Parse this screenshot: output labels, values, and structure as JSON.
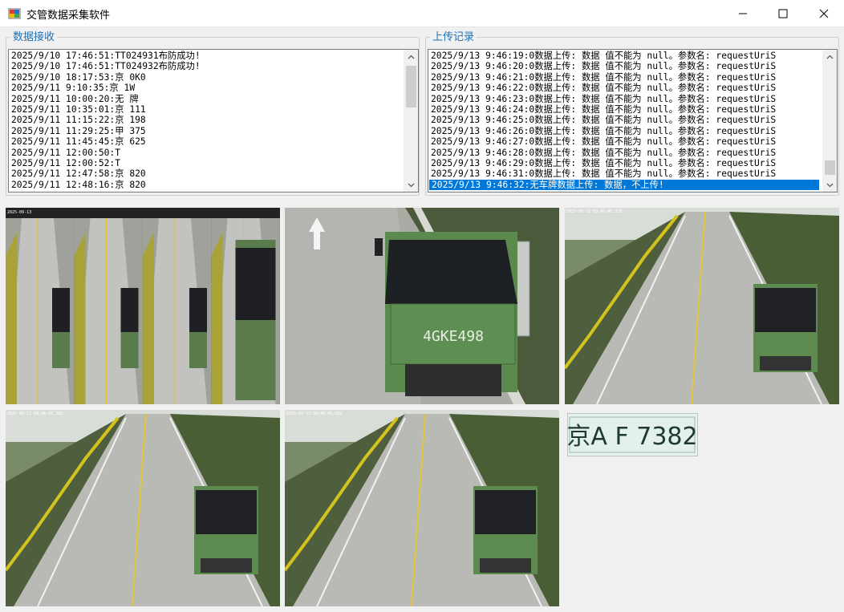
{
  "window": {
    "title": "交管数据采集软件",
    "icons": {
      "app": "app-icon",
      "minimize": "minimize-icon",
      "maximize": "maximize-icon",
      "close": "close-icon"
    }
  },
  "receive_panel": {
    "label": "数据接收",
    "lines": [
      "2025/9/10 17:46:51:TT024931布防成功!",
      "2025/9/10 17:46:51:TT024932布防成功!",
      "2025/9/10 18:17:53:京 0K0",
      "2025/9/11 9:10:35:京 1W",
      "2025/9/11 10:00:20:无 牌",
      "2025/9/11 10:35:01:京 111",
      "2025/9/11 11:15:22:京 198",
      "2025/9/11 11:29:25:甲 375",
      "2025/9/11 11:45:45:京 625",
      "2025/9/11 12:00:50:T",
      "2025/9/11 12:00:52:T",
      "2025/9/11 12:47:58:京 820",
      "2025/9/11 12:48:16:京 820"
    ]
  },
  "upload_panel": {
    "label": "上传记录",
    "lines": [
      "2025/9/13 9:46:19:0数据上传: 数据  值不能为 null。参数名: requestUriS",
      "2025/9/13 9:46:20:0数据上传: 数据  值不能为 null。参数名: requestUriS",
      "2025/9/13 9:46:21:0数据上传: 数据  值不能为 null。参数名: requestUriS",
      "2025/9/13 9:46:22:0数据上传: 数据  值不能为 null。参数名: requestUriS",
      "2025/9/13 9:46:23:0数据上传: 数据  值不能为 null。参数名: requestUriS",
      "2025/9/13 9:46:24:0数据上传: 数据  值不能为 null。参数名: requestUriS",
      "2025/9/13 9:46:25:0数据上传: 数据  值不能为 null。参数名: requestUriS",
      "2025/9/13 9:46:26:0数据上传: 数据  值不能为 null。参数名: requestUriS",
      "2025/9/13 9:46:27:0数据上传: 数据  值不能为 null。参数名: requestUriS",
      "2025/9/13 9:46:28:0数据上传: 数据  值不能为 null。参数名: requestUriS",
      "2025/9/13 9:46:29:0数据上传: 数据  值不能为 null。参数名: requestUriS",
      "2025/9/13 9:46:31:0数据上传: 数据  值不能为 null。参数名: requestUriS"
    ],
    "selected_line": "2025/9/13 9:46:32:无车牌数据上传:   数据，不上传!"
  },
  "images": {
    "plate_text": "京A F 7382",
    "truck_plate": "4GKE498",
    "timestamps": [
      "2025-09-13",
      "2025-09-13 09:46:45.318",
      "2025-09-13 09:46:45.302",
      "2025-09-13 09:46:45.292"
    ]
  }
}
